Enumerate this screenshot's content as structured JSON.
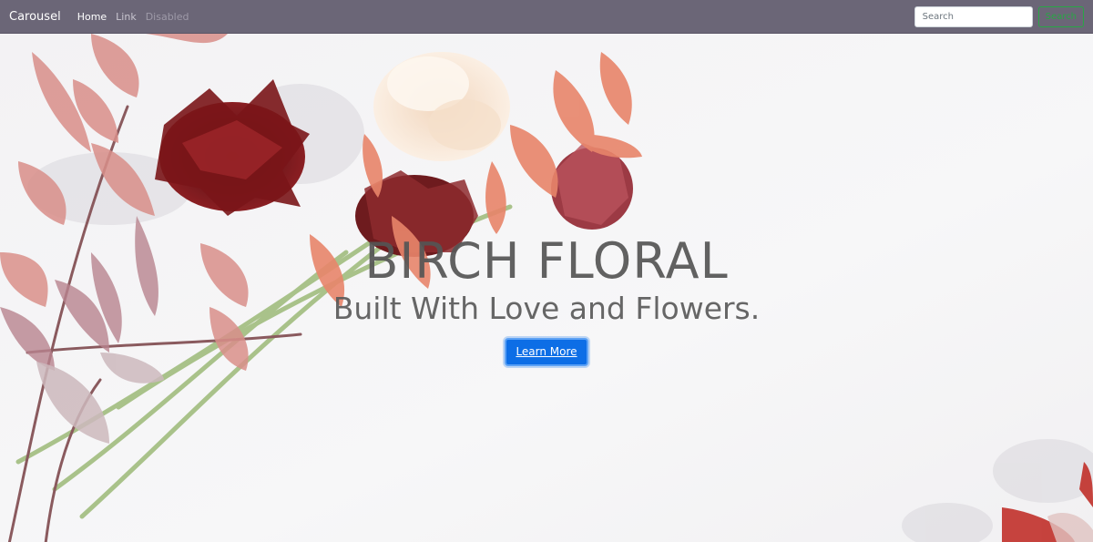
{
  "navbar": {
    "brand": "Carousel",
    "links": [
      {
        "label": "Home",
        "state": "active"
      },
      {
        "label": "Link",
        "state": "normal"
      },
      {
        "label": "Disabled",
        "state": "disabled"
      }
    ],
    "search": {
      "placeholder": "Search",
      "value": "",
      "button_label": "Search"
    },
    "colors": {
      "background": "#6b6677",
      "search_button": "#28a745"
    }
  },
  "hero": {
    "title": "BIRCH FLORAL",
    "subtitle": "Built With Love and Flowers.",
    "cta_label": "Learn More",
    "colors": {
      "cta": "#0d6ee6",
      "text": "#555555",
      "background": "#f6f6f7"
    }
  }
}
